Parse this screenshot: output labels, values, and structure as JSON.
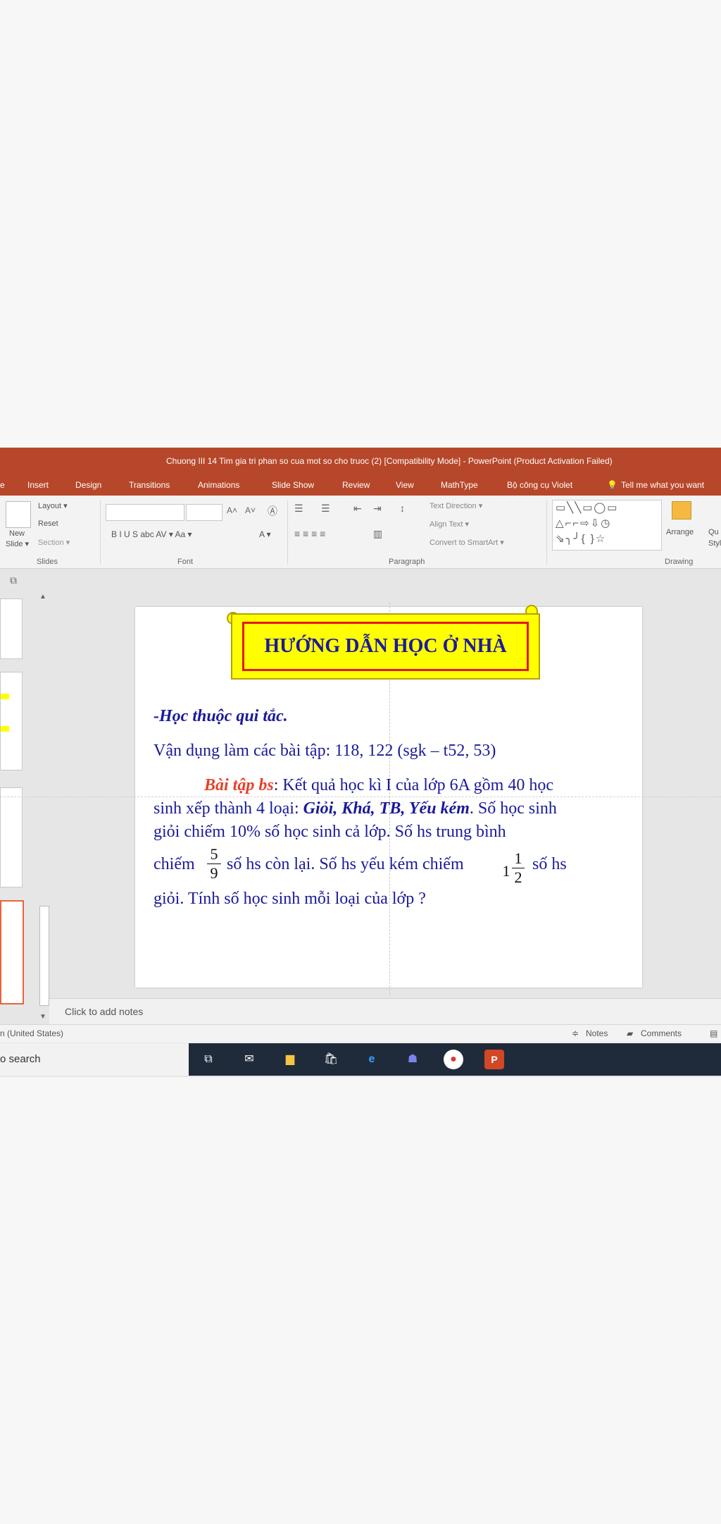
{
  "window": {
    "title": "Chuong III 14 Tim gia tri phan so cua mot so cho truoc (2) [Compatibility Mode] - PowerPoint (Product Activation Failed)"
  },
  "ribbon_tabs": [
    "e",
    "Insert",
    "Design",
    "Transitions",
    "Animations",
    "Slide Show",
    "Review",
    "View",
    "MathType",
    "Bộ công cụ Violet",
    "Tell me what you want"
  ],
  "ribbon": {
    "slides_group": "Slides",
    "font_group": "Font",
    "paragraph_group": "Paragraph",
    "drawing_group": "Drawing",
    "new_slide": "New",
    "new_slide_2": "Slide ▾",
    "layout": "Layout ▾",
    "reset": "Reset",
    "section": "Section ▾",
    "text_direction": "Text Direction ▾",
    "align_text": "Align Text ▾",
    "convert_smartart": "Convert to SmartArt ▾",
    "arrange": "Arrange",
    "quick_styles": "Qu",
    "quick_styles_2": "Styl",
    "font_buttons": "B  I  U  S  abc  AV ▾  Aa ▾",
    "font_color": "A ▾"
  },
  "slide": {
    "title": "HƯỚNG DẪN HỌC Ở NHÀ",
    "line1": "-Học thuộc qui tắc.",
    "line2": "Vận dụng làm các bài tập: 118, 122 (sgk – t52, 53)",
    "bt_label": "Bài tập bs",
    "line3_rest": ":  Kết quả học kì I của lớp 6A gồm 40 học",
    "line4_start": "sinh xếp thành 4 loại: ",
    "line4_bold": "Giỏi, Khá, TB, Yếu kém",
    "line4_end": ". Số học sinh",
    "line5": "giỏi chiếm 10%  số học sinh cả lớp. Số hs trung bình",
    "line6_a": "chiếm",
    "line6_b": "số hs còn lại. Số hs yếu kém chiếm",
    "line6_c": "số hs",
    "line7": "giỏi. Tính số học sinh mỗi loại của lớp ?",
    "frac1_num": "5",
    "frac1_den": "9",
    "mixed_whole": "1",
    "frac2_num": "1",
    "frac2_den": "2"
  },
  "notes_placeholder": "Click to add notes",
  "status": {
    "language": "n (United States)",
    "notes": "Notes",
    "comments": "Comments"
  },
  "taskbar": {
    "search_text": "o search"
  }
}
